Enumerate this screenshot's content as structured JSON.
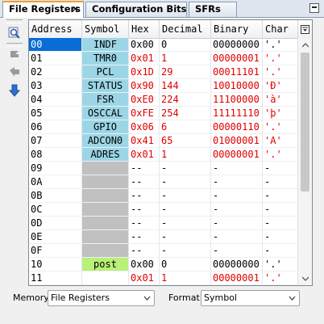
{
  "tabs": [
    {
      "label": "File Registers",
      "active": true,
      "closable": true
    },
    {
      "label": "Configuration Bits",
      "active": false
    },
    {
      "label": "SFRs",
      "active": false
    }
  ],
  "toolbar": {
    "icons": [
      "zoom-find-icon",
      "arrow-right-gray-icon",
      "arrow-left-gray-icon",
      "arrow-down-blue-icon"
    ]
  },
  "columns": [
    "Address",
    "Symbol",
    "Hex",
    "Decimal",
    "Binary",
    "Char"
  ],
  "rows": [
    {
      "address": "00",
      "symbol": "INDF",
      "hex": "0x00",
      "decimal": "0",
      "binary": "00000000",
      "char": "'.'",
      "changed": false,
      "selected": true,
      "kind": "sfr"
    },
    {
      "address": "01",
      "symbol": "TMR0",
      "hex": "0x01",
      "decimal": "1",
      "binary": "00000001",
      "char": "'.'",
      "changed": true,
      "kind": "sfr"
    },
    {
      "address": "02",
      "symbol": "PCL",
      "hex": "0x1D",
      "decimal": "29",
      "binary": "00011101",
      "char": "'.'",
      "changed": true,
      "kind": "sfr"
    },
    {
      "address": "03",
      "symbol": "STATUS",
      "hex": "0x90",
      "decimal": "144",
      "binary": "10010000",
      "char": "'Đ'",
      "changed": true,
      "kind": "sfr"
    },
    {
      "address": "04",
      "symbol": "FSR",
      "hex": "0xE0",
      "decimal": "224",
      "binary": "11100000",
      "char": "'à'",
      "changed": true,
      "kind": "sfr"
    },
    {
      "address": "05",
      "symbol": "OSCCAL",
      "hex": "0xFE",
      "decimal": "254",
      "binary": "11111110",
      "char": "'þ'",
      "changed": true,
      "kind": "sfr"
    },
    {
      "address": "06",
      "symbol": "GPIO",
      "hex": "0x06",
      "decimal": "6",
      "binary": "00000110",
      "char": "'.'",
      "changed": true,
      "kind": "sfr"
    },
    {
      "address": "07",
      "symbol": "ADCON0",
      "hex": "0x41",
      "decimal": "65",
      "binary": "01000001",
      "char": "'A'",
      "changed": true,
      "kind": "sfr"
    },
    {
      "address": "08",
      "symbol": "ADRES",
      "hex": "0x01",
      "decimal": "1",
      "binary": "00000001",
      "char": "'.'",
      "changed": true,
      "kind": "sfr"
    },
    {
      "address": "09",
      "symbol": "",
      "hex": "--",
      "decimal": "-",
      "binary": "-",
      "char": "-",
      "changed": false,
      "kind": "unimplemented"
    },
    {
      "address": "0A",
      "symbol": "",
      "hex": "--",
      "decimal": "-",
      "binary": "-",
      "char": "-",
      "changed": false,
      "kind": "unimplemented"
    },
    {
      "address": "0B",
      "symbol": "",
      "hex": "--",
      "decimal": "-",
      "binary": "-",
      "char": "-",
      "changed": false,
      "kind": "unimplemented"
    },
    {
      "address": "0C",
      "symbol": "",
      "hex": "--",
      "decimal": "-",
      "binary": "-",
      "char": "-",
      "changed": false,
      "kind": "unimplemented"
    },
    {
      "address": "0D",
      "symbol": "",
      "hex": "--",
      "decimal": "-",
      "binary": "-",
      "char": "-",
      "changed": false,
      "kind": "unimplemented"
    },
    {
      "address": "0E",
      "symbol": "",
      "hex": "--",
      "decimal": "-",
      "binary": "-",
      "char": "-",
      "changed": false,
      "kind": "unimplemented"
    },
    {
      "address": "0F",
      "symbol": "",
      "hex": "--",
      "decimal": "-",
      "binary": "-",
      "char": "-",
      "changed": false,
      "kind": "unimplemented"
    },
    {
      "address": "10",
      "symbol": "post",
      "hex": "0x00",
      "decimal": "0",
      "binary": "00000000",
      "char": "'.'",
      "changed": false,
      "kind": "user"
    },
    {
      "address": "11",
      "symbol": "",
      "hex": "0x01",
      "decimal": "1",
      "binary": "00000001",
      "char": "'.'",
      "changed": true,
      "kind": "plain"
    }
  ],
  "bottom": {
    "memory_label": "Memory",
    "memory_value": "File Registers",
    "format_label": "Format",
    "format_value": "Symbol"
  },
  "colors": {
    "sfr_symbol": "#9cd6e6",
    "unimplemented_symbol": "#c0c0c0",
    "user_symbol": "#b8f078",
    "changed_value": "#e00000",
    "selection": "#0a6cd6",
    "active_tab_accent": "#f0a030"
  }
}
